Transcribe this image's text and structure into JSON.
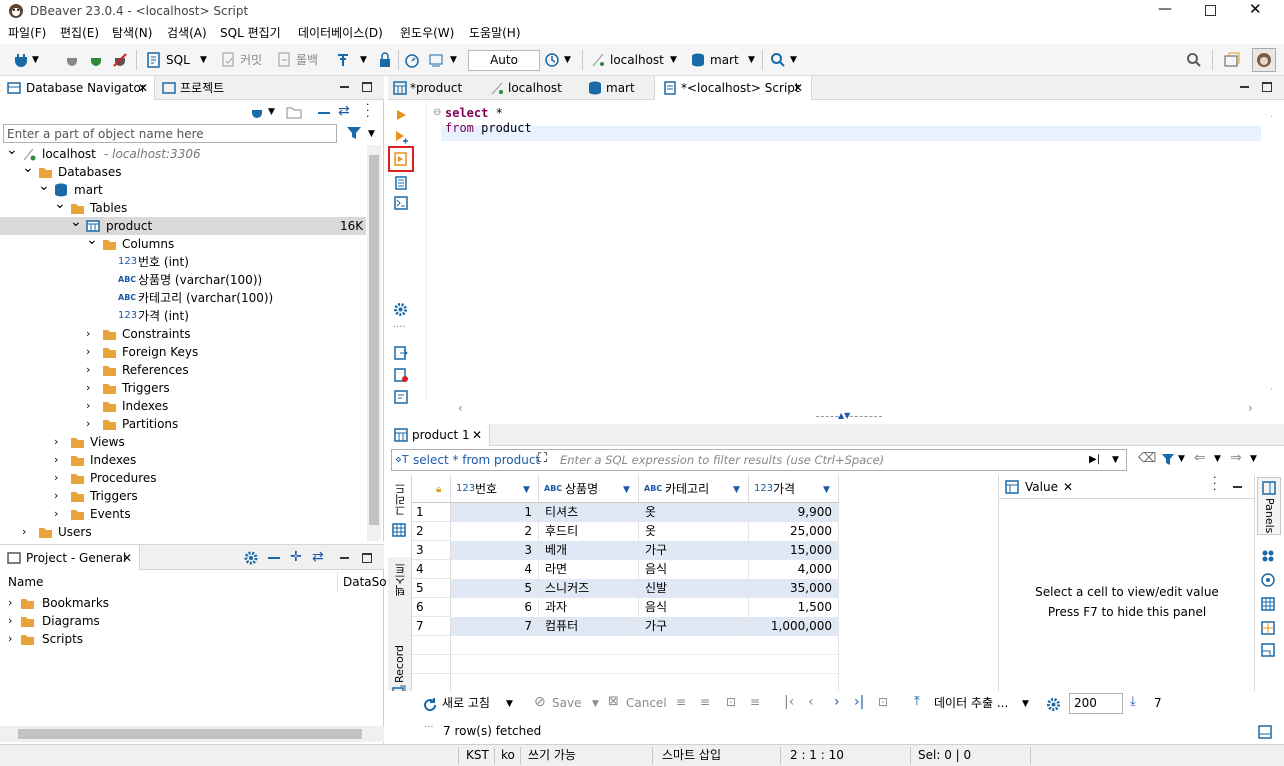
{
  "window": {
    "title": "DBeaver 23.0.4 - <localhost> Script"
  },
  "menu": [
    "파일(F)",
    "편집(E)",
    "탐색(N)",
    "검색(A)",
    "SQL 편집기",
    "데이터베이스(D)",
    "윈도우(W)",
    "도움말(H)"
  ],
  "toolbar": {
    "sql_label": "SQL",
    "commit_label": "커밋",
    "rollback_label": "롤백",
    "transaction_mode": "Auto",
    "datasource": "localhost",
    "schema": "mart"
  },
  "navigator": {
    "tab_label": "Database Navigator",
    "projects_tab_label": "프로젝트",
    "filter_placeholder": "Enter a part of object name here",
    "tree": [
      {
        "label": "localhost",
        "detail": " - localhost:3306",
        "level": 0,
        "icon": "server-icon",
        "open": true
      },
      {
        "label": "Databases",
        "level": 1,
        "icon": "folder-icon",
        "open": true
      },
      {
        "label": "mart",
        "level": 2,
        "icon": "database-icon",
        "open": true
      },
      {
        "label": "Tables",
        "level": 3,
        "icon": "folder-icon",
        "open": true
      },
      {
        "label": "product",
        "level": 4,
        "icon": "table-icon",
        "open": true,
        "selected": true,
        "size": "16K"
      },
      {
        "label": "Columns",
        "level": 5,
        "icon": "folder-icon",
        "open": true
      },
      {
        "label": "번호 (int)",
        "level": 6,
        "icon": "numeric-column-icon",
        "leaf": true
      },
      {
        "label": "상품명 (varchar(100))",
        "level": 6,
        "icon": "text-column-icon",
        "leaf": true
      },
      {
        "label": "카테고리 (varchar(100))",
        "level": 6,
        "icon": "text-column-icon",
        "leaf": true
      },
      {
        "label": "가격 (int)",
        "level": 6,
        "icon": "numeric-column-icon",
        "leaf": true
      },
      {
        "label": "Constraints",
        "level": 5,
        "icon": "folder-icon"
      },
      {
        "label": "Foreign Keys",
        "level": 5,
        "icon": "folder-icon"
      },
      {
        "label": "References",
        "level": 5,
        "icon": "folder-icon"
      },
      {
        "label": "Triggers",
        "level": 5,
        "icon": "folder-icon"
      },
      {
        "label": "Indexes",
        "level": 5,
        "icon": "folder-icon"
      },
      {
        "label": "Partitions",
        "level": 5,
        "icon": "folder-icon"
      },
      {
        "label": "Views",
        "level": 3,
        "icon": "folder-icon"
      },
      {
        "label": "Indexes",
        "level": 3,
        "icon": "folder-icon"
      },
      {
        "label": "Procedures",
        "level": 3,
        "icon": "folder-icon"
      },
      {
        "label": "Triggers",
        "level": 3,
        "icon": "folder-icon"
      },
      {
        "label": "Events",
        "level": 3,
        "icon": "folder-icon"
      },
      {
        "label": "Users",
        "level": 1,
        "icon": "folder-icon"
      }
    ]
  },
  "project": {
    "tab_label": "Project - General",
    "col_name": "Name",
    "col_datasource": "DataSo",
    "items": [
      "Bookmarks",
      "Diagrams",
      "Scripts"
    ]
  },
  "editor": {
    "tabs": [
      "*product",
      "localhost",
      "mart",
      "*<localhost> Script"
    ],
    "code_line1_kw": "select",
    "code_line1_rest": " *",
    "code_line2_kw": "from",
    "code_line2_rest": " product"
  },
  "results": {
    "tab_label": "product 1",
    "query_text": "select * from product",
    "filter_placeholder": "Enter a SQL expression to filter results (use Ctrl+Space)",
    "side_tabs": {
      "grid": "그리드",
      "text": "텍스트",
      "record": "Record"
    },
    "columns": [
      {
        "type": "123",
        "name": "번호"
      },
      {
        "type": "ABC",
        "name": "상품명"
      },
      {
        "type": "ABC",
        "name": "카테고리"
      },
      {
        "type": "123",
        "name": "가격"
      }
    ],
    "rows": [
      [
        "1",
        "1",
        "티셔츠",
        "옷",
        "9,900"
      ],
      [
        "2",
        "2",
        "후드티",
        "옷",
        "25,000"
      ],
      [
        "3",
        "3",
        "베개",
        "가구",
        "15,000"
      ],
      [
        "4",
        "4",
        "라면",
        "음식",
        "4,000"
      ],
      [
        "5",
        "5",
        "스니커즈",
        "신발",
        "35,000"
      ],
      [
        "6",
        "6",
        "과자",
        "음식",
        "1,500"
      ],
      [
        "7",
        "7",
        "컴퓨터",
        "가구",
        "1,000,000"
      ]
    ],
    "value_panel": {
      "title": "Value",
      "hint1": "Select a cell to view/edit value",
      "hint2": "Press F7 to hide this panel",
      "panels_label": "Panels"
    },
    "bottom": {
      "refresh": "새로 고침",
      "save": "Save",
      "cancel": "Cancel",
      "export": "데이터 추출 ...",
      "fetch_size": "200",
      "row_count": "7",
      "fetched": "7 row(s) fetched"
    }
  },
  "status": [
    "KST",
    "ko",
    "쓰기 가능",
    "스마트 삽입",
    "2 : 1 : 10",
    "Sel: 0 | 0"
  ],
  "colors": {
    "accent": "#1a5aa8",
    "keyword": "#7f0055",
    "selection": "#d9d9d9",
    "folder": "#e8a33a",
    "highlight_box": "#e02020"
  }
}
